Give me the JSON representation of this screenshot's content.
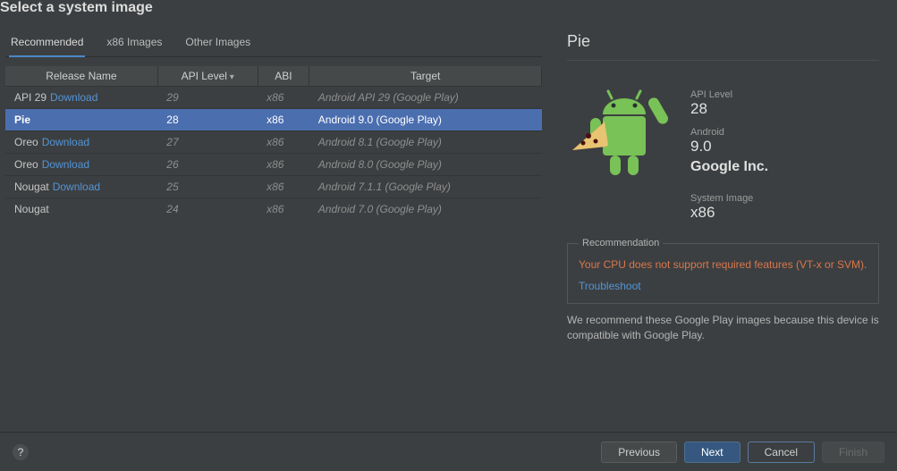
{
  "title": "Select a system image",
  "tabs": [
    "Recommended",
    "x86 Images",
    "Other Images"
  ],
  "active_tab": 0,
  "columns": [
    "Release Name",
    "API Level",
    "ABI",
    "Target"
  ],
  "rows": [
    {
      "release": "API 29",
      "download": "Download",
      "api": "29",
      "abi": "x86",
      "target": "Android API 29 (Google Play)",
      "selected": false
    },
    {
      "release": "Pie",
      "download": null,
      "api": "28",
      "abi": "x86",
      "target": "Android 9.0 (Google Play)",
      "selected": true
    },
    {
      "release": "Oreo",
      "download": "Download",
      "api": "27",
      "abi": "x86",
      "target": "Android 8.1 (Google Play)",
      "selected": false
    },
    {
      "release": "Oreo",
      "download": "Download",
      "api": "26",
      "abi": "x86",
      "target": "Android 8.0 (Google Play)",
      "selected": false
    },
    {
      "release": "Nougat",
      "download": "Download",
      "api": "25",
      "abi": "x86",
      "target": "Android 7.1.1 (Google Play)",
      "selected": false
    },
    {
      "release": "Nougat",
      "download": null,
      "api": "24",
      "abi": "x86",
      "target": "Android 7.0 (Google Play)",
      "selected": false
    }
  ],
  "detail": {
    "name": "Pie",
    "api_label": "API Level",
    "api": "28",
    "android_label": "Android",
    "android": "9.0",
    "company": "Google Inc.",
    "sysimg_label": "System Image",
    "sysimg": "x86"
  },
  "recommendation": {
    "legend": "Recommendation",
    "warning": "Your CPU does not support required features (VT-x or SVM).",
    "troubleshoot": "Troubleshoot",
    "note": "We recommend these Google Play images because this device is compatible with Google Play."
  },
  "buttons": {
    "help": "?",
    "previous": "Previous",
    "next": "Next",
    "cancel": "Cancel",
    "finish": "Finish"
  }
}
